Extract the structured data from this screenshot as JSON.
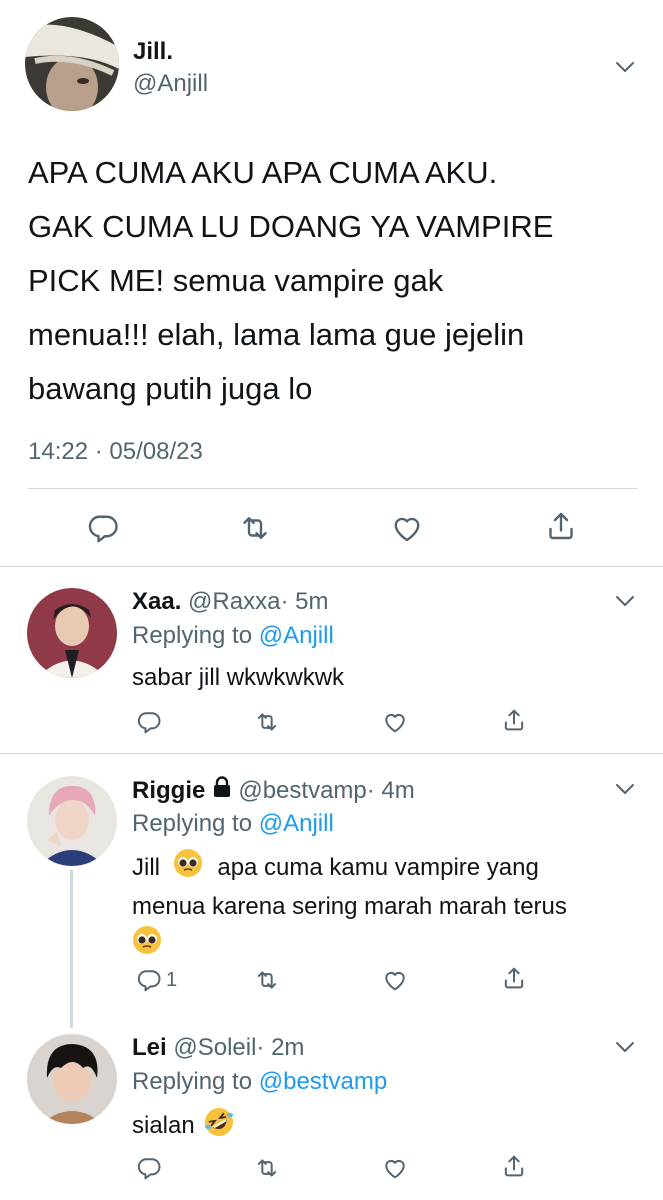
{
  "main_tweet": {
    "display_name": "Jill.",
    "handle": "@Anjill",
    "text_lines": [
      "APA CUMA AKU APA CUMA AKU.",
      "GAK CUMA LU DOANG YA VAMPIRE",
      "PICK ME! semua vampire gak",
      "menua!!! elah, lama lama gue jejelin",
      "bawang putih juga lo"
    ],
    "timestamp": "14:22 · 05/08/23",
    "actions": [
      "reply-icon",
      "retweet-icon",
      "like-icon",
      "share-icon"
    ]
  },
  "replies": [
    {
      "display_name": "Xaa.",
      "handle": "@Raxxa",
      "time": "· 5m",
      "replying_prefix": "Replying to",
      "replying_handle": "@Anjill",
      "text_lines": [
        "sabar jill wkwkwkwk"
      ]
    },
    {
      "display_name": "Riggie",
      "locked": true,
      "handle": "@bestvamp",
      "time": "· 4m",
      "replying_prefix": "Replying to",
      "replying_handle": "@Anjill",
      "text_line1_a": "Jill",
      "text_line1_b": "apa cuma kamu vampire yang",
      "text_line2": "menua karena sering marah marah terus",
      "reply_count": "1"
    },
    {
      "display_name": "Lei",
      "handle": "@Soleil",
      "time": "· 2m",
      "replying_prefix": "Replying to",
      "replying_handle": "@bestvamp",
      "text": "sialan"
    }
  ],
  "colors": {
    "text": "#0f1419",
    "muted": "#536471",
    "link": "#1d9bf0",
    "divider": "#cfd9de",
    "thread_line": "#cfd9de"
  }
}
